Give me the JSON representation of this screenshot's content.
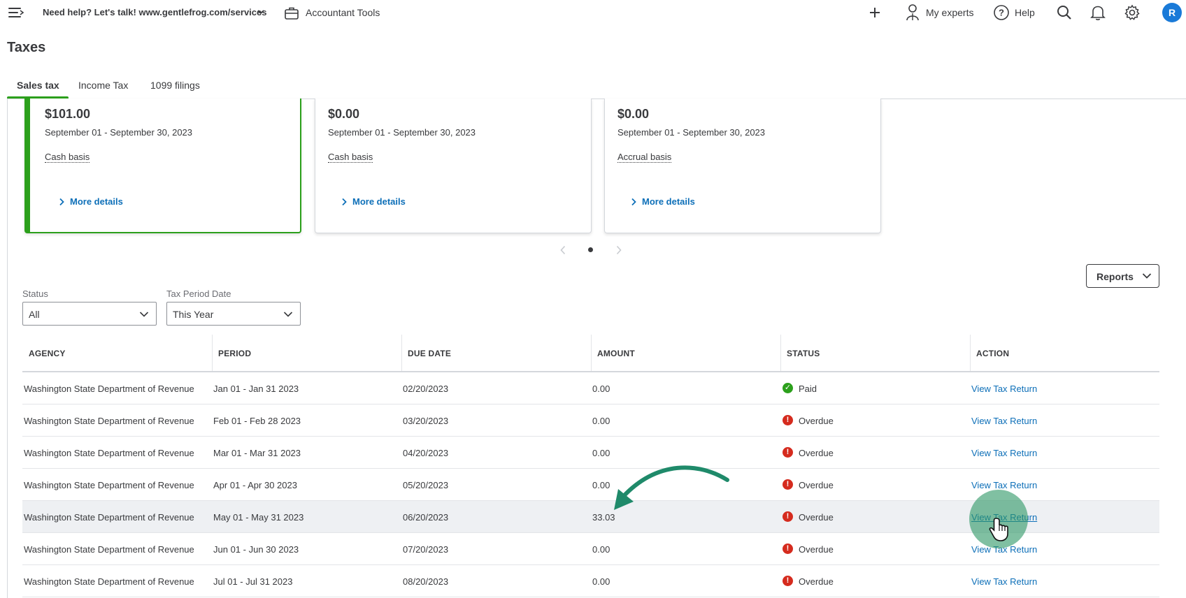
{
  "header": {
    "help_link": "Need help? Let's talk! www.gentlefrog.com/services",
    "accountant_tools": "Accountant Tools",
    "my_experts": "My experts",
    "help": "Help",
    "avatar_initial": "R"
  },
  "page": {
    "title": "Taxes"
  },
  "tabs": [
    {
      "label": "Sales tax",
      "active": true
    },
    {
      "label": "Income Tax",
      "active": false
    },
    {
      "label": "1099 filings",
      "active": false
    }
  ],
  "cards": [
    {
      "amount": "$101.00",
      "period": "September 01 - September 30, 2023",
      "basis": "Cash basis",
      "more": "More details",
      "selected": true
    },
    {
      "amount": "$0.00",
      "period": "September 01 - September 30, 2023",
      "basis": "Cash basis",
      "more": "More details",
      "selected": false
    },
    {
      "amount": "$0.00",
      "period": "September 01 - September 30, 2023",
      "basis": "Accrual basis",
      "more": "More details",
      "selected": false
    }
  ],
  "reports_button": "Reports",
  "filters": {
    "status": {
      "label": "Status",
      "value": "All"
    },
    "tax_period": {
      "label": "Tax Period Date",
      "value": "This Year"
    }
  },
  "table": {
    "headers": [
      "AGENCY",
      "PERIOD",
      "DUE DATE",
      "AMOUNT",
      "STATUS",
      "ACTION"
    ],
    "rows": [
      {
        "agency": "Washington State Department of Revenue",
        "period": "Jan 01 - Jan 31 2023",
        "due": "02/20/2023",
        "amount": "0.00",
        "status": "Paid",
        "action": "View Tax Return"
      },
      {
        "agency": "Washington State Department of Revenue",
        "period": "Feb 01 - Feb 28 2023",
        "due": "03/20/2023",
        "amount": "0.00",
        "status": "Overdue",
        "action": "View Tax Return"
      },
      {
        "agency": "Washington State Department of Revenue",
        "period": "Mar 01 - Mar 31 2023",
        "due": "04/20/2023",
        "amount": "0.00",
        "status": "Overdue",
        "action": "View Tax Return"
      },
      {
        "agency": "Washington State Department of Revenue",
        "period": "Apr 01 - Apr 30 2023",
        "due": "05/20/2023",
        "amount": "0.00",
        "status": "Overdue",
        "action": "View Tax Return"
      },
      {
        "agency": "Washington State Department of Revenue",
        "period": "May 01 - May 31 2023",
        "due": "06/20/2023",
        "amount": "33.03",
        "status": "Overdue",
        "action": "View Tax Return"
      },
      {
        "agency": "Washington State Department of Revenue",
        "period": "Jun 01 - Jun 30 2023",
        "due": "07/20/2023",
        "amount": "0.00",
        "status": "Overdue",
        "action": "View Tax Return"
      },
      {
        "agency": "Washington State Department of Revenue",
        "period": "Jul 01 - Jul 31 2023",
        "due": "08/20/2023",
        "amount": "0.00",
        "status": "Overdue",
        "action": "View Tax Return"
      }
    ]
  },
  "colors": {
    "accent_green": "#2ca01c",
    "link_blue": "#0d6fb8",
    "overdue_red": "#d52b1e",
    "annotation_teal": "#1f8a6a"
  },
  "icons": [
    "menu-icon",
    "chevron-down-icon",
    "briefcase-icon",
    "plus-icon",
    "experts-icon",
    "help-icon",
    "search-icon",
    "bell-icon",
    "gear-icon",
    "chevron-right-icon",
    "chevron-left-icon",
    "check-icon",
    "alert-icon",
    "hand-cursor-icon"
  ]
}
